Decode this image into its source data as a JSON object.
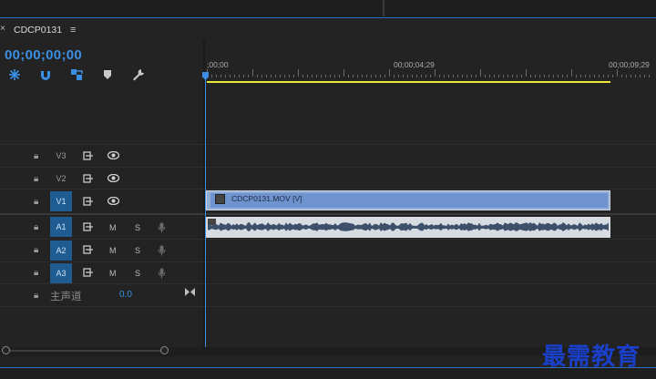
{
  "panel": {
    "close_glyph": "×",
    "sequence_title": "CDCP0131",
    "menu_glyph": "≡",
    "timecode": "00;00;00;00"
  },
  "toolbar": {
    "tools": [
      {
        "name": "nest-sequence-icon",
        "color": "#3a8fe4"
      },
      {
        "name": "snap-magnet-icon",
        "color": "#3a8fe4"
      },
      {
        "name": "linked-selection-icon",
        "color": "#3a8fe4"
      },
      {
        "name": "add-marker-icon",
        "color": "#c9c9c9"
      },
      {
        "name": "timeline-settings-wrench-icon",
        "color": "#c9c9c9"
      }
    ]
  },
  "ruler": {
    "labels": [
      ";00;00",
      "00;00;04;29",
      "00;00;09;29"
    ]
  },
  "tracks": [
    {
      "id": "V3",
      "kind": "video",
      "selected": false
    },
    {
      "id": "V2",
      "kind": "video",
      "selected": false
    },
    {
      "id": "V1",
      "kind": "video",
      "selected": true
    },
    {
      "id": "A1",
      "kind": "audio",
      "selected": true,
      "mute": "M",
      "solo": "S"
    },
    {
      "id": "A2",
      "kind": "audio",
      "selected": true,
      "mute": "M",
      "solo": "S"
    },
    {
      "id": "A3",
      "kind": "audio",
      "selected": true,
      "mute": "M",
      "solo": "S"
    }
  ],
  "labels": {
    "v3": "V3",
    "v2": "V2",
    "v1": "V1",
    "a1": "A1",
    "a2": "A2",
    "a3": "A3",
    "m": "M",
    "s": "S"
  },
  "master": {
    "label": "主声道",
    "value": "0.0"
  },
  "clips": {
    "video": {
      "label": "CDCP0131.MOV [V]"
    }
  },
  "colors": {
    "accent": "#3a8fe4",
    "work_area": "#ece63a",
    "track_selected": "#1e5c91",
    "video_clip": "#6f93cf",
    "watermark": "#1a3fc8"
  },
  "watermark": "最需教育"
}
